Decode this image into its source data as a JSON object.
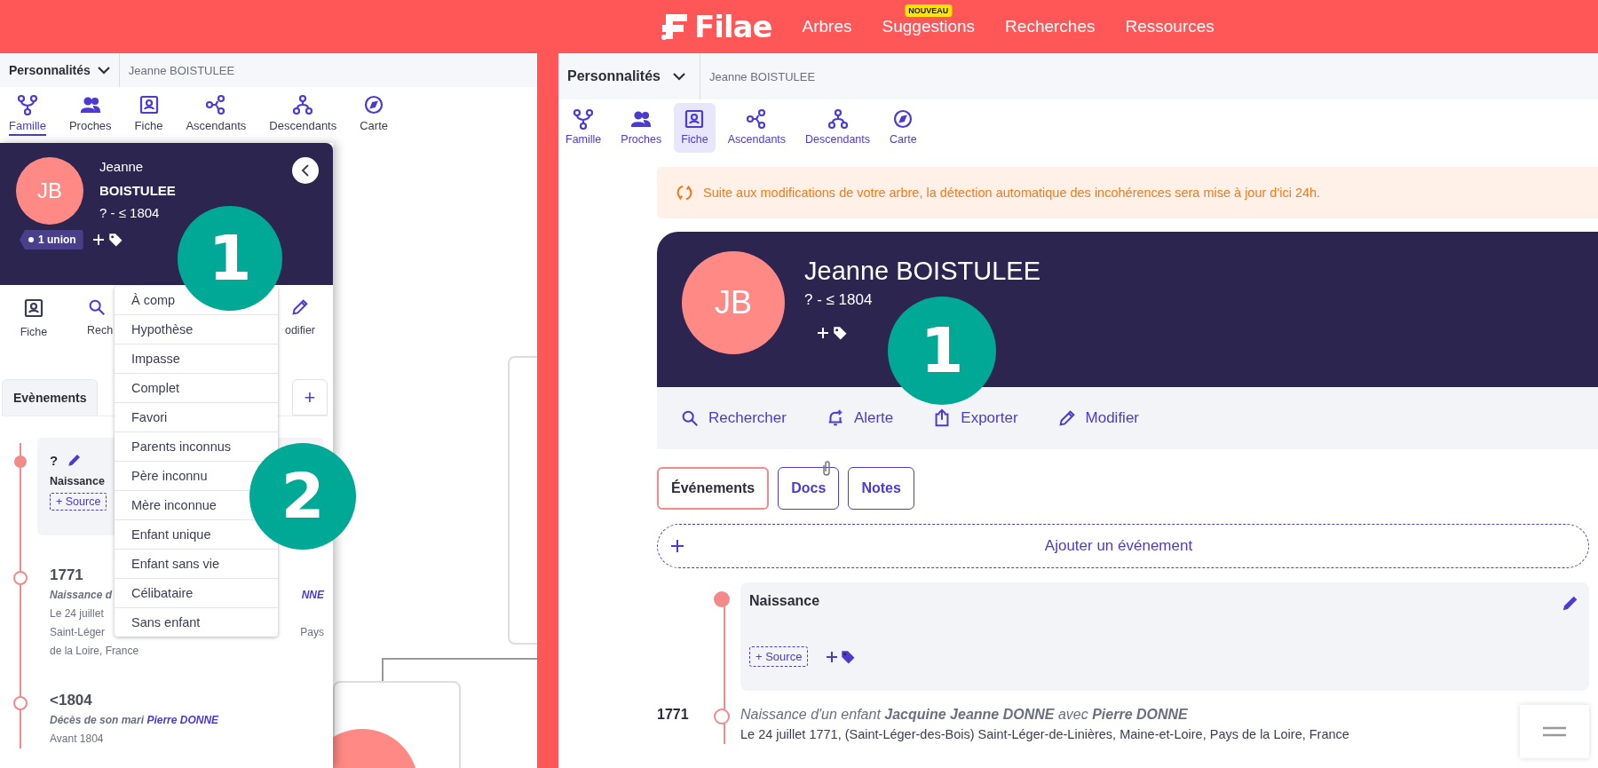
{
  "header": {
    "logo": "Filae",
    "nav": [
      {
        "label": "Arbres"
      },
      {
        "label": "Suggestions",
        "badge": "NOUVEAU"
      },
      {
        "label": "Recherches"
      },
      {
        "label": "Ressources"
      }
    ]
  },
  "left": {
    "breadcrumb": {
      "dropdown": "Personnalités",
      "person": "Jeanne BOISTULEE"
    },
    "views": [
      {
        "label": "Famille",
        "selected": true
      },
      {
        "label": "Proches",
        "selected": false
      },
      {
        "label": "Fiche",
        "selected": false
      },
      {
        "label": "Ascendants",
        "selected": false
      },
      {
        "label": "Descendants",
        "selected": false
      },
      {
        "label": "Carte",
        "selected": false
      }
    ],
    "card": {
      "initials": "JB",
      "first_name": "Jeanne",
      "last_name": "BOISTULEE",
      "dates": "? - ≤ 1804",
      "union_tag": "1 union"
    },
    "actions": [
      "Fiche",
      "Rech",
      "odifier"
    ],
    "tabs": [
      {
        "label": "Evènements",
        "selected": true
      }
    ],
    "add_tab": "+",
    "first_event": {
      "date": "?",
      "title": "Naissance",
      "source": "+ Source"
    },
    "events": [
      {
        "date": "1771",
        "rows": [
          {
            "left": "Naissance d",
            "right": "NNE",
            "kind": "title"
          },
          {
            "left": "Le 24 juillet",
            "right": "",
            "kind": "text"
          },
          {
            "left": "Saint-Léger",
            "right": "Pays",
            "kind": "text"
          },
          {
            "left": "de la Loire, France",
            "right": "",
            "kind": "full"
          }
        ]
      },
      {
        "date": "<1804",
        "rows": [
          {
            "left": "Décès de son mari ",
            "right": "Pierre DONNE",
            "kind": "inline"
          },
          {
            "left": "Avant 1804",
            "right": "",
            "kind": "full"
          }
        ]
      }
    ],
    "tag_menu": [
      "À comp",
      "Hypothèse",
      "Impasse",
      "Complet",
      "Favori",
      "Parents inconnus",
      "Père inconnu",
      "Mère inconnue",
      "Enfant unique",
      "Enfant sans vie",
      "Célibataire",
      "Sans enfant"
    ],
    "markers": [
      "1",
      "2"
    ]
  },
  "right": {
    "breadcrumb": {
      "dropdown": "Personnalités",
      "person": "Jeanne BOISTULEE"
    },
    "views": [
      {
        "label": "Famille",
        "selected": false
      },
      {
        "label": "Proches",
        "selected": false
      },
      {
        "label": "Fiche",
        "selected": true
      },
      {
        "label": "Ascendants",
        "selected": false
      },
      {
        "label": "Descendants",
        "selected": false
      },
      {
        "label": "Carte",
        "selected": false
      }
    ],
    "banner": "Suite aux modifications de votre arbre, la détection automatique des incohérences sera mise à jour d'ici 24h.",
    "card": {
      "initials": "JB",
      "name": "Jeanne BOISTULEE",
      "dates": "? - ≤ 1804"
    },
    "actions": [
      "Rechercher",
      "Alerte",
      "Exporter",
      "Modifier"
    ],
    "tabs": [
      {
        "label": "Événements",
        "selected": true,
        "has_attachment": false
      },
      {
        "label": "Docs",
        "selected": false,
        "has_attachment": true
      },
      {
        "label": "Notes",
        "selected": false,
        "has_attachment": false
      }
    ],
    "add_event": "Ajouter un événement",
    "first_event": {
      "title": "Naissance",
      "source": "+ Source"
    },
    "event": {
      "date": "1771",
      "title": "*Naissance d'un enfant* **Jacquine Jeanne DONNE** *avec* **Pierre DONNE**",
      "detail": "Le 24 juillet 1771, (Saint-Léger-des-Bois) Saint-Léger-de-Linières, Maine-et-Loire, Pays de la Loire, France"
    },
    "marker": "1"
  }
}
